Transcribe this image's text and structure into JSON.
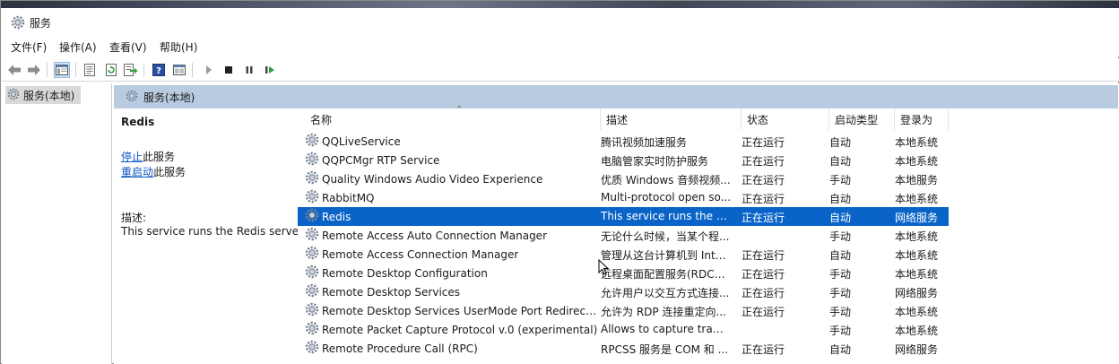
{
  "window": {
    "title": "服务"
  },
  "menu": {
    "items": [
      "文件(F)",
      "操作(A)",
      "查看(V)",
      "帮助(H)"
    ]
  },
  "toolbar": {
    "buttons": [
      "back-icon",
      "forward-icon",
      "show-hide-tree-icon",
      "properties-icon",
      "refresh-icon",
      "export-list-icon",
      "help-icon",
      "console-view-icon",
      "start-icon",
      "stop-icon",
      "pause-icon",
      "resume-icon"
    ]
  },
  "tree": {
    "root_label": "服务(本地)"
  },
  "header": {
    "label": "服务(本地)"
  },
  "details": {
    "service_name": "Redis",
    "stop_link": "停止",
    "stop_suffix": "此服务",
    "restart_link": "重启动",
    "restart_suffix": "此服务",
    "description_label": "描述:",
    "description_text": "This service runs the Redis server"
  },
  "table": {
    "columns": {
      "name": "名称",
      "description": "描述",
      "status": "状态",
      "startup": "启动类型",
      "logon": "登录为"
    },
    "rows": [
      {
        "name": "QQLiveService",
        "description": "腾讯视频加速服务",
        "status": "正在运行",
        "startup": "自动",
        "logon": "本地系统",
        "selected": false
      },
      {
        "name": "QQPCMgr RTP Service",
        "description": "电脑管家实时防护服务",
        "status": "正在运行",
        "startup": "自动",
        "logon": "本地系统",
        "selected": false
      },
      {
        "name": "Quality Windows Audio Video Experience",
        "description": "优质 Windows 音频视频...",
        "status": "正在运行",
        "startup": "手动",
        "logon": "本地服务",
        "selected": false
      },
      {
        "name": "RabbitMQ",
        "description": "Multi-protocol open so...",
        "status": "正在运行",
        "startup": "自动",
        "logon": "本地系统",
        "selected": false
      },
      {
        "name": "Redis",
        "description": "This service runs the R...",
        "status": "正在运行",
        "startup": "自动",
        "logon": "网络服务",
        "selected": true
      },
      {
        "name": "Remote Access Auto Connection Manager",
        "description": "无论什么时候，当某个程...",
        "status": "",
        "startup": "手动",
        "logon": "本地系统",
        "selected": false
      },
      {
        "name": "Remote Access Connection Manager",
        "description": "管理从这台计算机到 Inte...",
        "status": "正在运行",
        "startup": "自动",
        "logon": "本地系统",
        "selected": false
      },
      {
        "name": "Remote Desktop Configuration",
        "description": "远程桌面配置服务(RDCS)...",
        "status": "正在运行",
        "startup": "手动",
        "logon": "本地系统",
        "selected": false
      },
      {
        "name": "Remote Desktop Services",
        "description": "允许用户以交互方式连接...",
        "status": "正在运行",
        "startup": "手动",
        "logon": "网络服务",
        "selected": false
      },
      {
        "name": "Remote Desktop Services UserMode Port Redirect...",
        "description": "允许为 RDP 连接重定向...",
        "status": "正在运行",
        "startup": "手动",
        "logon": "本地系统",
        "selected": false
      },
      {
        "name": "Remote Packet Capture Protocol v.0 (experimental)",
        "description": "Allows to capture traffi...",
        "status": "",
        "startup": "手动",
        "logon": "本地系统",
        "selected": false
      },
      {
        "name": "Remote Procedure Call (RPC)",
        "description": "RPCSS 服务是 COM 和 ...",
        "status": "正在运行",
        "startup": "自动",
        "logon": "网络服务",
        "selected": false
      }
    ]
  },
  "colors": {
    "header_bar": "#b8cbe0",
    "selection": "#0a64c8",
    "link": "#0b57c9"
  }
}
